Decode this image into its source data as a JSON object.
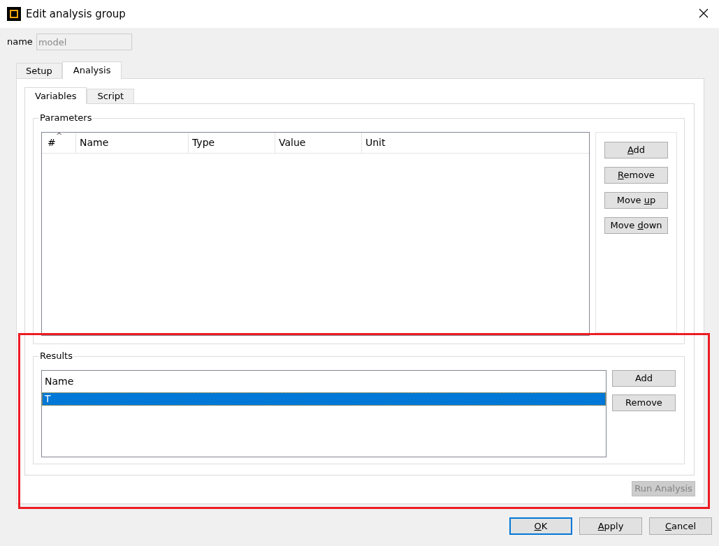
{
  "window": {
    "title": "Edit analysis group"
  },
  "name_field": {
    "label": "name",
    "value": "model",
    "disabled": true
  },
  "tabs": [
    {
      "label": "Setup",
      "selected": false
    },
    {
      "label": "Analysis",
      "selected": true
    }
  ],
  "subtabs": [
    {
      "label": "Variables",
      "selected": true
    },
    {
      "label": "Script",
      "selected": false
    }
  ],
  "parameters": {
    "title": "Parameters",
    "sort_indicator": "^",
    "columns": [
      "#",
      "Name",
      "Type",
      "Value",
      "Unit"
    ],
    "buttons": [
      {
        "key": "A",
        "after": "dd"
      },
      {
        "key": "R",
        "after": "emove"
      },
      {
        "before": "Move ",
        "key": "u",
        "after": "p"
      },
      {
        "before": "Move ",
        "key": "d",
        "after": "own"
      }
    ]
  },
  "results": {
    "title": "Results",
    "columns": [
      "Name"
    ],
    "rows": [
      {
        "name": "T",
        "selected": true
      }
    ],
    "buttons": [
      {
        "before": "Add"
      },
      {
        "before": "Remove"
      }
    ]
  },
  "run_button": {
    "label": "Run Analysis",
    "disabled": true
  },
  "dialog_buttons": [
    {
      "key": "O",
      "after": "K",
      "default": true
    },
    {
      "key": "A",
      "after": "pply",
      "default": false
    },
    {
      "key": "C",
      "after": "ancel",
      "default": false
    }
  ],
  "annotations": [
    {
      "kind": "highlight-rectangle",
      "color": "#ed1c24"
    }
  ]
}
